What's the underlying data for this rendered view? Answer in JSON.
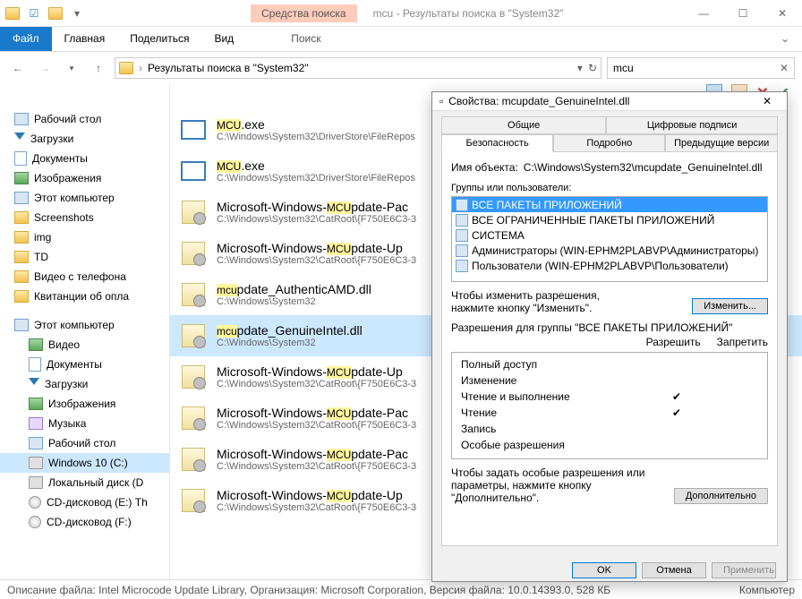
{
  "window": {
    "tool_context": "Средства поиска",
    "title": "mcu - Результаты поиска в \"System32\""
  },
  "ribbon": {
    "file": "Файл",
    "home": "Главная",
    "share": "Поделиться",
    "view": "Вид",
    "search": "Поиск"
  },
  "nav": {
    "breadcrumb": "Результаты поиска в \"System32\"",
    "search_value": "mcu"
  },
  "tree": [
    {
      "label": "Рабочий стол",
      "ico": "pc",
      "indent": 0
    },
    {
      "label": "Загрузки",
      "ico": "dl",
      "indent": 0
    },
    {
      "label": "Документы",
      "ico": "doc",
      "indent": 0
    },
    {
      "label": "Изображения",
      "ico": "img",
      "indent": 0
    },
    {
      "label": "Этот компьютер",
      "ico": "pc",
      "indent": 0
    },
    {
      "label": "Screenshots",
      "ico": "folder",
      "indent": 0
    },
    {
      "label": "img",
      "ico": "folder",
      "indent": 0
    },
    {
      "label": "TD",
      "ico": "folder",
      "indent": 0
    },
    {
      "label": "Видео с телефона",
      "ico": "folder",
      "indent": 0
    },
    {
      "label": "Квитанции об опла",
      "ico": "folder",
      "indent": 0
    },
    {
      "label": "Этот компьютер",
      "ico": "pc",
      "indent": 0,
      "spacer": true
    },
    {
      "label": "Видео",
      "ico": "img",
      "indent": 1
    },
    {
      "label": "Документы",
      "ico": "doc",
      "indent": 1
    },
    {
      "label": "Загрузки",
      "ico": "dl",
      "indent": 1
    },
    {
      "label": "Изображения",
      "ico": "img",
      "indent": 1
    },
    {
      "label": "Музыка",
      "ico": "music",
      "indent": 1
    },
    {
      "label": "Рабочий стол",
      "ico": "pc",
      "indent": 1
    },
    {
      "label": "Windows 10 (C:)",
      "ico": "drive",
      "indent": 1,
      "sel": true
    },
    {
      "label": "Локальный диск (D",
      "ico": "drive",
      "indent": 1
    },
    {
      "label": "CD-дисковод (E:) Th",
      "ico": "disc",
      "indent": 1
    },
    {
      "label": "CD-дисковод (F:)",
      "ico": "disc",
      "indent": 1
    }
  ],
  "results": [
    {
      "name_pre": "",
      "name_hl": "MCU",
      "name_post": ".exe",
      "path": "C:\\Windows\\System32\\DriverStore\\FileRepos",
      "ico": "exe"
    },
    {
      "name_pre": "",
      "name_hl": "MCU",
      "name_post": ".exe",
      "path": "C:\\Windows\\System32\\DriverStore\\FileRepos",
      "ico": "exe"
    },
    {
      "name_pre": "Microsoft-Windows-",
      "name_hl": "MCU",
      "name_post": "pdate-Pac",
      "path": "C:\\Windows\\System32\\CatRoot\\{F750E6C3-3",
      "ico": "dll"
    },
    {
      "name_pre": "Microsoft-Windows-",
      "name_hl": "MCU",
      "name_post": "pdate-Up",
      "path": "C:\\Windows\\System32\\CatRoot\\{F750E6C3-3",
      "ico": "dll"
    },
    {
      "name_pre": "",
      "name_hl": "mcu",
      "name_post": "pdate_AuthenticAMD.dll",
      "path": "C:\\Windows\\System32",
      "ico": "dll"
    },
    {
      "name_pre": "",
      "name_hl": "mcu",
      "name_post": "pdate_GenuineIntel.dll",
      "path": "C:\\Windows\\System32",
      "ico": "dll",
      "sel": true
    },
    {
      "name_pre": "Microsoft-Windows-",
      "name_hl": "MCU",
      "name_post": "pdate-Up",
      "path": "C:\\Windows\\System32\\CatRoot\\{F750E6C3-3",
      "ico": "dll"
    },
    {
      "name_pre": "Microsoft-Windows-",
      "name_hl": "MCU",
      "name_post": "pdate-Pac",
      "path": "C:\\Windows\\System32\\CatRoot\\{F750E6C3-3",
      "ico": "dll"
    },
    {
      "name_pre": "Microsoft-Windows-",
      "name_hl": "MCU",
      "name_post": "pdate-Pac",
      "path": "C:\\Windows\\System32\\CatRoot\\{F750E6C3-3",
      "ico": "dll"
    },
    {
      "name_pre": "Microsoft-Windows-",
      "name_hl": "MCU",
      "name_post": "pdate-Up",
      "path": "C:\\Windows\\System32\\CatRoot\\{F750E6C3-3",
      "ico": "dll"
    }
  ],
  "status": {
    "left": "Описание файла: Intel Microcode Update Library, Организация: Microsoft Corporation, Версия файла: 10.0.14393.0,  528 КБ",
    "right": "Компьютер"
  },
  "dialog": {
    "title_prefix": "Свойства: ",
    "title_file": "mcupdate_GenuineIntel.dll",
    "tabs": {
      "general": "Общие",
      "sigs": "Цифровые подписи",
      "security": "Безопасность",
      "details": "Подробно",
      "prev": "Предыдущие версии"
    },
    "object_label": "Имя объекта:",
    "object_path": "C:\\Windows\\System32\\mcupdate_GenuineIntel.dll",
    "groups_label": "Группы или пользователи:",
    "groups": [
      {
        "label": "ВСЕ ПАКЕТЫ ПРИЛОЖЕНИЙ",
        "sel": true
      },
      {
        "label": "ВСЕ ОГРАНИЧЕННЫЕ ПАКЕТЫ ПРИЛОЖЕНИЙ"
      },
      {
        "label": "СИСТЕМА"
      },
      {
        "label": "Администраторы (WIN-EPHM2PLABVP\\Администраторы)"
      },
      {
        "label": "Пользователи (WIN-EPHM2PLABVP\\Пользователи)"
      }
    ],
    "edit_note": "Чтобы изменить разрешения, нажмите кнопку \"Изменить\".",
    "edit_btn": "Изменить...",
    "perm_header": "Разрешения для группы \"ВСЕ ПАКЕТЫ ПРИЛОЖЕНИЙ\"",
    "allow": "Разрешить",
    "deny": "Запретить",
    "perms": [
      {
        "label": "Полный доступ",
        "allow": false
      },
      {
        "label": "Изменение",
        "allow": false
      },
      {
        "label": "Чтение и выполнение",
        "allow": true
      },
      {
        "label": "Чтение",
        "allow": true
      },
      {
        "label": "Запись",
        "allow": false
      },
      {
        "label": "Особые разрешения",
        "allow": false
      }
    ],
    "adv_note": "Чтобы задать особые разрешения или параметры, нажмите кнопку \"Дополнительно\".",
    "adv_btn": "Дополнительно",
    "ok": "OK",
    "cancel": "Отмена",
    "apply": "Применить"
  }
}
